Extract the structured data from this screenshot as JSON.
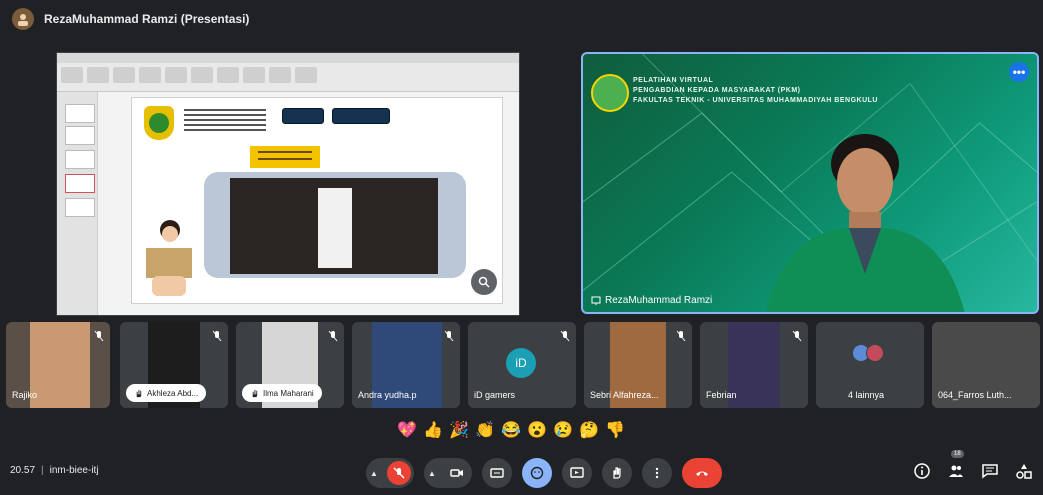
{
  "header": {
    "title": "RezaMuhammad Ramzi (Presentasi)"
  },
  "speaker": {
    "name": "RezaMuhammad Ramzi",
    "banner": [
      "PELATIHAN VIRTUAL",
      "PENGABDIAN KEPADA MASYARAKAT (PKM)",
      "FAKULTAS TEKNIK - UNIVERSITAS MUHAMMADIYAH BENGKULU"
    ],
    "more_label": "•••"
  },
  "filmstrip": [
    {
      "name": "Rajiko",
      "style": "label"
    },
    {
      "name": "Akhleza Abd...",
      "style": "chip"
    },
    {
      "name": "Ilma Maharani",
      "style": "chip"
    },
    {
      "name": "Andra yudha.p",
      "style": "label"
    },
    {
      "name": "iD gamers",
      "style": "label",
      "avatar": "iD"
    },
    {
      "name": "Sebri Alfahreza...",
      "style": "label"
    },
    {
      "name": "Febrian",
      "style": "label"
    },
    {
      "name": "4 lainnya",
      "style": "label"
    },
    {
      "name": "064_Farros Luth...",
      "style": "label"
    }
  ],
  "reactions": [
    "💖",
    "👍",
    "🎉",
    "👏",
    "😂",
    "😮",
    "😢",
    "🤔",
    "👎"
  ],
  "meeting": {
    "time": "20.57",
    "separator": "|",
    "code": "inm-biee-itj"
  },
  "participants_count": "18",
  "colors": {
    "end_call": "#ea4335",
    "accent": "#8ab4f8",
    "bar": "#3c4043"
  }
}
